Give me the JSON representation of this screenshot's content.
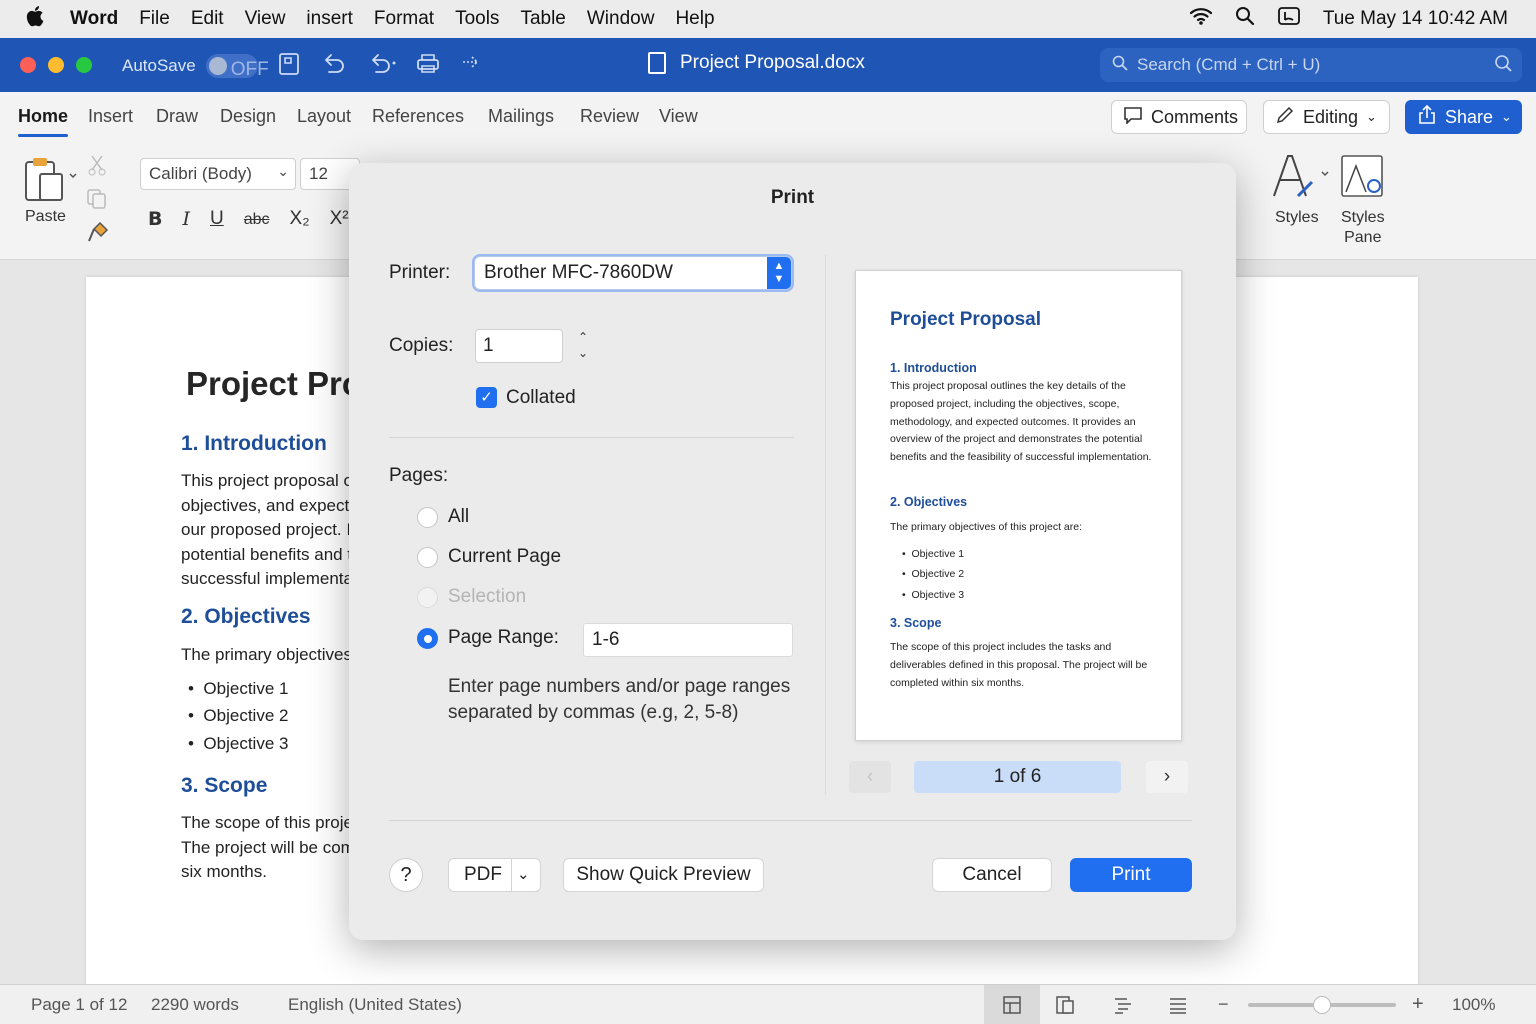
{
  "menubar": {
    "apple": "",
    "app": "Word",
    "items": [
      "File",
      "Edit",
      "View",
      "insert",
      "Format",
      "Tools",
      "Table",
      "Window",
      "Help"
    ],
    "clock": "Tue May 14  10:42 AM"
  },
  "titlebar": {
    "autosave_label": "AutoSave",
    "autosave_state": "OFF",
    "document_title": "Project Proposal.docx",
    "search_placeholder": "Search (Cmd + Ctrl + U)"
  },
  "ribbon": {
    "tabs": [
      "Home",
      "Insert",
      "Draw",
      "Design",
      "Layout",
      "References",
      "Mailings",
      "Review",
      "View"
    ],
    "active_tab": "Home",
    "comments_label": "Comments",
    "editing_label": "Editing",
    "share_label": "Share",
    "paste_label": "Paste",
    "font_name": "Calibri (Body)",
    "font_size": "12",
    "format_buttons": [
      "B",
      "I",
      "U",
      "abc",
      "X₂",
      "X²"
    ],
    "styles_label": "Styles",
    "styles_pane_label_1": "Styles",
    "styles_pane_label_2": "Pane"
  },
  "document": {
    "title": "Project Proposal",
    "h1": "1. Introduction",
    "intro_lines": [
      "This project proposal outlines the key details of",
      "objectives, and expected outcomes of",
      "our proposed project. It provides an",
      "potential benefits and the feasibility of",
      "successful implementation."
    ],
    "h2": "2. Objectives",
    "objectives_intro": "The primary objectives of this project are:",
    "bullets": [
      "Objective 1",
      "Objective 2",
      "Objective 3"
    ],
    "h3": "3. Scope",
    "scope_lines": [
      "The scope of this project includes the tasks",
      "The project will be completed within",
      "six months."
    ]
  },
  "statusbar": {
    "page": "Page 1 of 12",
    "words": "2290 words",
    "language": "English (United States)",
    "zoom": "100%",
    "zoom_fraction": 0.5
  },
  "print_dialog": {
    "title": "Print",
    "printer_label": "Printer:",
    "printer_value": "Brother MFC-7860DW",
    "copies_label": "Copies:",
    "copies_value": "1",
    "collated_label": "Collated",
    "collated_checked": true,
    "pages_label": "Pages:",
    "options": [
      "All",
      "Current Page",
      "Selection",
      "Page Range:"
    ],
    "selected_option": "Page Range:",
    "page_range_value": "1-6",
    "hint_line1": "Enter page numbers and/or page ranges",
    "hint_line2": "separated by commas (e.g, 2, 5-8)",
    "preview_counter": "1 of 6",
    "help_label": "?",
    "pdf_label": "PDF",
    "quick_preview_label": "Show Quick Preview",
    "cancel_label": "Cancel",
    "print_label": "Print"
  },
  "preview": {
    "title": "Project Proposal",
    "h1": "1. Introduction",
    "p1": "This project proposal outlines the key details of the proposed project, including the objectives, scope, methodology, and expected outcomes. It provides an overview of the project and demonstrates the potential benefits and the feasibility of successful implementation.",
    "h2": "2. Objectives",
    "p2": "The primary objectives of this project are:",
    "bullets": [
      "Objective 1",
      "Objective 2",
      "Objective 3"
    ],
    "h3": "3. Scope",
    "p3": "The scope of this project includes the tasks and deliverables defined in this proposal. The project will be completed within six months."
  },
  "colors": {
    "titlebar": "#1f55b4",
    "accent": "#1f6ff0",
    "heading": "#1f4e99"
  }
}
